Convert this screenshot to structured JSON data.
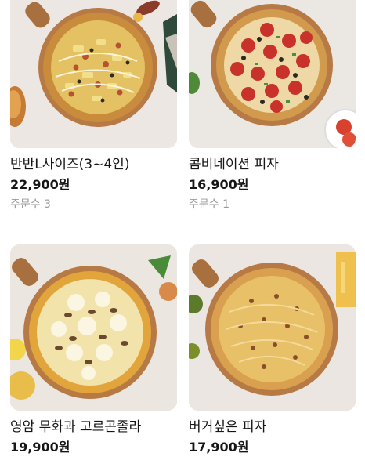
{
  "products": [
    {
      "name": "반반L사이즈(3~4인)",
      "price": "22,900원",
      "orders": "주문수 3"
    },
    {
      "name": "콤비네이션 피자",
      "price": "16,900원",
      "orders": "주문수 1"
    },
    {
      "name": "영암 무화과 고르곤졸라",
      "price": "19,900원",
      "orders": ""
    },
    {
      "name": "버거싶은 피자",
      "price": "17,900원",
      "orders": ""
    }
  ]
}
